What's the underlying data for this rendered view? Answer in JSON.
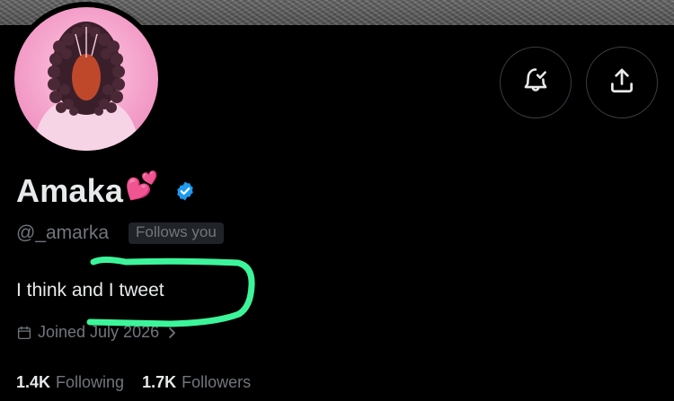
{
  "profile": {
    "display_name": "Amaka",
    "name_emoji": "💕",
    "handle": "@_amarka",
    "follows_you": "Follows you",
    "bio": "I think and I tweet",
    "joined": "Joined July 2026",
    "following_count": "1.4K",
    "following_label": "Following",
    "followers_count": "1.7K",
    "followers_label": "Followers"
  },
  "actions": {
    "notify_icon": "bell-check-icon",
    "share_icon": "share-upload-icon"
  },
  "colors": {
    "background": "#000000",
    "primary_text": "#e7e9ea",
    "secondary_text": "#71767b",
    "verified_blue": "#1d9bf0",
    "highlight_green": "#3cf59a",
    "avatar_pink": "#f4a6cf"
  }
}
